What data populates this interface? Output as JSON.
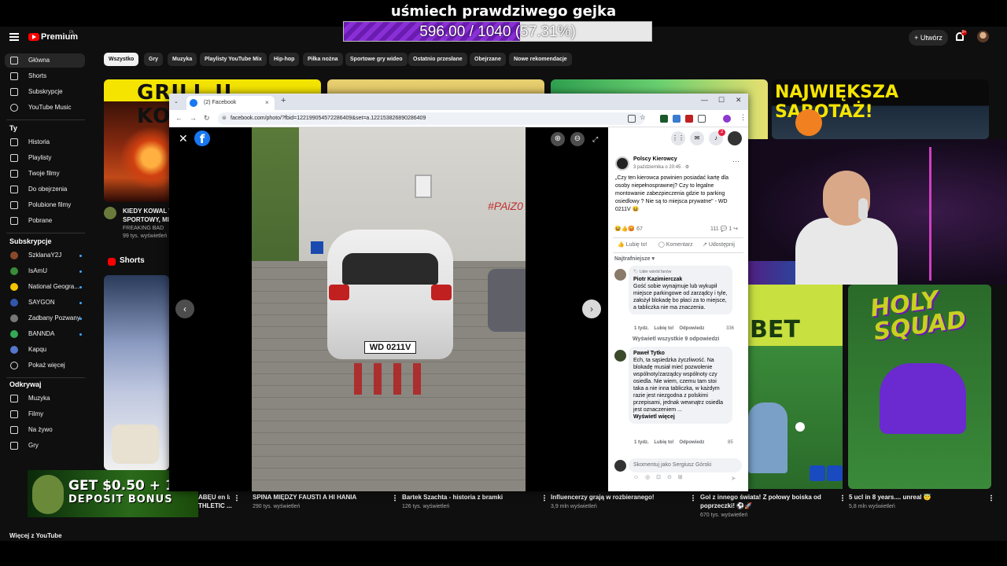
{
  "overlay": {
    "title": "uśmiech prawdziwego gejka",
    "progress_value": 596.0,
    "progress_max": 1040,
    "progress_text": "596.00 / 1040 (57.31%)",
    "progress_fraction": 0.5731
  },
  "header": {
    "logo_text": "Premium",
    "logo_sup": "PL",
    "create_label": "+ Utwórz",
    "notification_count": "9+"
  },
  "sidebar": {
    "main": [
      {
        "label": "Główna",
        "icon": "home-icon"
      },
      {
        "label": "Shorts",
        "icon": "shorts-icon"
      },
      {
        "label": "Subskrypcje",
        "icon": "subscriptions-icon"
      },
      {
        "label": "YouTube Music",
        "icon": "music-icon"
      }
    ],
    "you_heading": "Ty",
    "you": [
      {
        "label": "Historia",
        "icon": "history-icon"
      },
      {
        "label": "Playlisty",
        "icon": "playlist-icon"
      },
      {
        "label": "Twoje filmy",
        "icon": "video-icon"
      },
      {
        "label": "Do obejrzenia",
        "icon": "clock-icon"
      },
      {
        "label": "Polubione filmy",
        "icon": "like-icon"
      },
      {
        "label": "Pobrane",
        "icon": "download-icon"
      }
    ],
    "subs_heading": "Subskrypcje",
    "subs": [
      {
        "label": "SzklanaY2J",
        "color": "#8a4a2a"
      },
      {
        "label": "IsAmU",
        "color": "#3a8a3a"
      },
      {
        "label": "National Geogra...",
        "color": "#f5c400"
      },
      {
        "label": "SAYGON",
        "color": "#3355aa"
      },
      {
        "label": "Zadbany Pozwany",
        "color": "#777777"
      },
      {
        "label": "BANNDA",
        "color": "#33aa55"
      },
      {
        "label": "Kapqu",
        "color": "#5577cc"
      },
      {
        "label": "Pokaż więcej",
        "color": ""
      }
    ],
    "explore_heading": "Odkrywaj",
    "explore": [
      {
        "label": "Muzyka",
        "icon": "music-note-icon"
      },
      {
        "label": "Filmy",
        "icon": "film-icon"
      },
      {
        "label": "Na żywo",
        "icon": "live-icon"
      },
      {
        "label": "Gry",
        "icon": "gamepad-icon"
      }
    ],
    "more_heading": "Więcej z YouTube"
  },
  "chips": [
    "Wszystko",
    "Gry",
    "Muzyka",
    "Playlisty YouTube Mix",
    "Hip-hop",
    "Piłka nożna",
    "Sportowe gry wideo",
    "Ostatnio przesłane",
    "Obejrzane",
    "Nowe rekomendacje"
  ],
  "videos_top": {
    "v1_banner": "GRILL U KOWALA",
    "v1_title": "KIEDY KOWAL W",
    "v1_title2": "SPORTOWY, MIC",
    "v1_channel": "FREAKING BAD",
    "v1_views": "99 tys. wyświetleń",
    "v4_banner": "NAJWIĘKSZA SABOTAŻ!"
  },
  "shorts_heading": "Shorts",
  "shorts_bottom": [
    {
      "title": "ABĘU en la",
      "title2": "THLETIC ...",
      "meta": ""
    },
    {
      "title": "SPINA MIĘDZY FAUSTI A HI HANIA",
      "title2": "",
      "meta": "290 tys. wyświetleń"
    },
    {
      "title": "Bartek Szachta - historia z bramki",
      "title2": "",
      "meta": "126 tys. wyświetleń"
    },
    {
      "title": "Influencerzy grają w rozbieranego!",
      "title2": "",
      "meta": "3,9 mln wyświetleń"
    },
    {
      "title": "Gol z innego świata! Z połowy boiska od",
      "title2": "poprzeczki! ⚽🚀",
      "meta": "670 tys. wyświetleń"
    },
    {
      "title": "5 ucl in 8 years.... unreal 😇",
      "title2": "",
      "meta": "5,8 mln wyświetleń"
    }
  ],
  "holy_squad_text": "HOLY SQUAD",
  "browser": {
    "tab_title": "(2) Facebook",
    "url": "facebook.com/photo/?fbid=122199054572286409&set=a.122153826890286409",
    "tab_close": "×",
    "new_tab": "+",
    "win_min": "—",
    "win_max": "☐",
    "win_close": "✕"
  },
  "viewer": {
    "close": "✕",
    "logo": "f",
    "zoom": "⊕",
    "plate": "WD 0211V",
    "graffiti": "#PAiZ0"
  },
  "post": {
    "notifications": "2",
    "page_name": "Polscy Kierowcy",
    "time": "3 października o 20:45 · ⚙",
    "more": "···",
    "text": "„Czy ten kierowca powinien posiadać kartę dla osoby niepełnosprawnej? Czy to legalne montowanie zabezpieczenia gdzie to parking osiedlowy ? Nie są to miejsca prywatne\" - WD 0211V 😆",
    "reaction_count": "67",
    "comment_count": "111",
    "share_count": "1",
    "like_label": "Lubię to!",
    "comment_label": "Komentarz",
    "share_label": "Udostępnij",
    "sort_label": "Najtrafniejsze ▾",
    "comments": [
      {
        "badge": "🏷 Lider wśród fanów",
        "name": "Piotr Kazimierczak",
        "text": "Gość sobie wynajmuje lub wykupił miejsce parkingowe od zarządcy i tyle, założył blokadę bo płaci za to miejsce, a tabliczka nie ma znaczenia.",
        "meta_time": "1 tydz.",
        "meta_like": "Lubię to!",
        "meta_reply": "Odpowiedz",
        "likes": "336"
      },
      {
        "badge": "",
        "name": "Paweł Tytko",
        "text": "Ech, ta sąsiedzka życzliwość. Na blokadę musiał mieć pozwolenie wspólnoty/zarządcy wspólnoty czy osiedla. Nie wiem, czemu tam stoi taka a nie inna tabliczka, w każdym razie jest niezgodna z polskimi przepisami, jednak wewnątrz osiedla jest oznaczeniem ...",
        "more": "Wyświetl więcej",
        "meta_time": "1 tydz.",
        "meta_like": "Lubię to!",
        "meta_reply": "Odpowiedz",
        "likes": "85"
      }
    ],
    "view_replies": "Wyświetl wszystkie 9 odpowiedzi",
    "comment_placeholder": "Skomentuj jako Sergiusz Górski",
    "comment_tools": "☺ ◎ ⊡ ⊙ ⊞"
  },
  "ad": {
    "line1": "GET $0.50 + 10%",
    "line2": "DEPOSIT BONUS"
  },
  "colors": {
    "yt_bg": "#0f0f0f",
    "fb_blue": "#1877f2",
    "progress_purple": "#7a22c4",
    "banner_yellow": "#f5e400"
  }
}
